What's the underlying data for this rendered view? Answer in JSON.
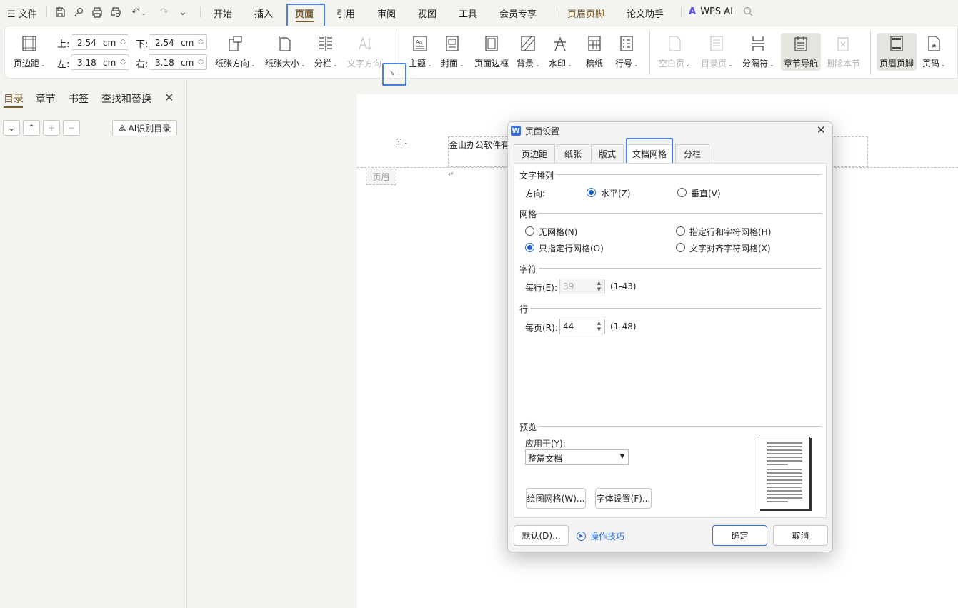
{
  "menu": {
    "file": "文件",
    "tabs": [
      "开始",
      "插入",
      "页面",
      "引用",
      "审阅",
      "视图",
      "工具",
      "会员专享",
      "页眉页脚",
      "论文助手"
    ],
    "wps_ai": "WPS AI"
  },
  "ribbon": {
    "margins_label": "页边距",
    "top_label": "上:",
    "top_value": "2.54",
    "top_unit": "cm",
    "bottom_label": "下:",
    "bottom_value": "2.54",
    "bottom_unit": "cm",
    "left_label": "左:",
    "left_value": "3.18",
    "left_unit": "cm",
    "right_label": "右:",
    "right_value": "3.18",
    "right_unit": "cm",
    "orientation": "纸张方向",
    "size": "纸张大小",
    "columns": "分栏",
    "text_direction": "文字方向",
    "theme": "主题",
    "cover": "封面",
    "page_border": "页面边框",
    "background": "背景",
    "watermark": "水印",
    "manuscript": "稿纸",
    "line_numbers": "行号",
    "blank_page": "空白页",
    "toc_page": "目录页",
    "separator": "分隔符",
    "section_nav": "章节导航",
    "delete_section": "删除本节",
    "header_footer": "页眉页脚",
    "page_number": "页码"
  },
  "left_panel": {
    "tabs": [
      "目录",
      "章节",
      "书签",
      "查找和替换"
    ],
    "ai_toc": "AI识别目录"
  },
  "document": {
    "header_text": "金山办公软件有",
    "header_label": "页眉",
    "para_mark": "↵"
  },
  "dialog": {
    "title": "页面设置",
    "tabs": [
      "页边距",
      "纸张",
      "版式",
      "文档网格",
      "分栏"
    ],
    "active_tab": "文档网格",
    "text_flow": {
      "section": "文字排列",
      "direction_label": "方向:",
      "horizontal": "水平(Z)",
      "vertical": "垂直(V)",
      "selected": "水平(Z)"
    },
    "grid": {
      "section": "网格",
      "none": "无网格(N)",
      "lines_and_chars": "指定行和字符网格(H)",
      "lines_only": "只指定行网格(O)",
      "snap_chars": "文字对齐字符网格(X)",
      "selected": "只指定行网格(O)"
    },
    "chars": {
      "section": "字符",
      "per_line_label": "每行(E):",
      "per_line_value": "39",
      "range": "(1-43)"
    },
    "lines": {
      "section": "行",
      "per_page_label": "每页(R):",
      "per_page_value": "44",
      "range": "(1-48)"
    },
    "preview": {
      "section": "预览",
      "apply_label": "应用于(Y):",
      "apply_value": "整篇文档"
    },
    "draw_grid_btn": "绘图网格(W)...",
    "font_settings_btn": "字体设置(F)...",
    "default_btn": "默认(D)...",
    "tips_link": "操作技巧",
    "ok_btn": "确定",
    "cancel_btn": "取消"
  },
  "colors": {
    "accent": "#2f6fd6",
    "highlight": "#4a7ee8",
    "active_tab": "#7a5a2a"
  }
}
